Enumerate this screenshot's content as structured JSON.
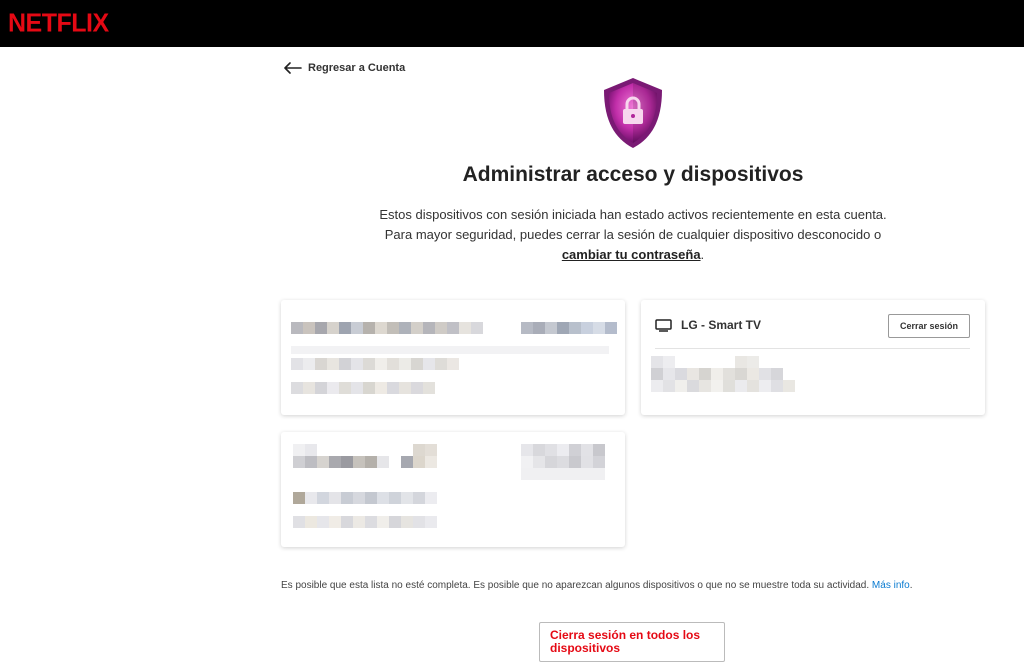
{
  "header": {
    "brand": "NETFLIX",
    "brand_color": "#e50914"
  },
  "nav": {
    "back_label": "Regresar a Cuenta"
  },
  "page": {
    "title": "Administrar acceso y dispositivos",
    "description_text": "Estos dispositivos con sesión iniciada han estado activos recientemente en esta cuenta. Para mayor seguridad, puedes cerrar la sesión de cualquier dispositivo desconocido o ",
    "password_link": "cambiar tu contraseña",
    "description_end": "."
  },
  "devices": [
    {
      "name": "LG - Smart TV",
      "signout_label": "Cerrar sesión",
      "icon": "tv-icon"
    }
  ],
  "footer": {
    "note": "Es posible que esta lista no esté completa. Es posible que no aparezcan algunos dispositivos o que no se muestre toda su actividad. ",
    "more_link": "Más info",
    "note_end": ".",
    "signout_all_label": "Cierra sesión en todos los dispositivos"
  },
  "colors": {
    "accent": "#e50914",
    "link": "#0a7bd1",
    "shield": "#b0279b"
  }
}
